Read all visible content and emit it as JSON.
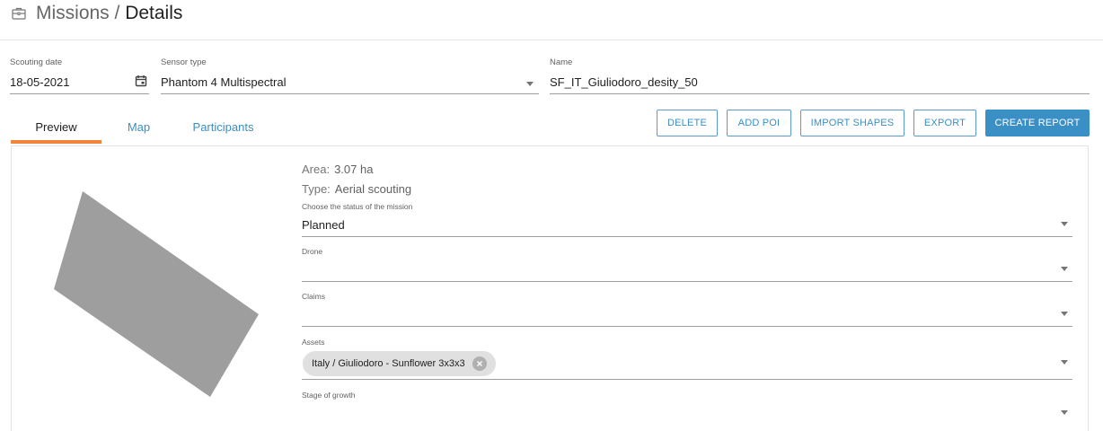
{
  "header": {
    "icon": "briefcase-icon",
    "section": "Missions",
    "separator": " / ",
    "current": "Details"
  },
  "form": {
    "scouting_date": {
      "label": "Scouting date",
      "value": "18-05-2021",
      "icon": "calendar-icon"
    },
    "sensor_type": {
      "label": "Sensor type",
      "value": "Phantom 4 Multispectral"
    },
    "name": {
      "label": "Name",
      "value": "SF_IT_Giuliodoro_desity_50"
    }
  },
  "tabs": [
    {
      "label": "Preview",
      "active": true
    },
    {
      "label": "Map",
      "active": false
    },
    {
      "label": "Participants",
      "active": false
    }
  ],
  "actions": {
    "delete": "DELETE",
    "add_poi": "ADD POI",
    "import_shapes": "IMPORT SHAPES",
    "export": "EXPORT",
    "create_report": "CREATE REPORT"
  },
  "details": {
    "area": {
      "label": "Area:",
      "value": "3.07 ha"
    },
    "type": {
      "label": "Type:",
      "value": "Aerial scouting"
    },
    "status": {
      "label": "Choose the status of the mission",
      "value": "Planned"
    },
    "drone": {
      "label": "Drone",
      "value": ""
    },
    "claims": {
      "label": "Claims",
      "value": ""
    },
    "assets": {
      "label": "Assets",
      "chip": "Italy / Giuliodoro - Sunflower 3x3x3"
    },
    "stage": {
      "label": "Stage of growth",
      "value": ""
    }
  },
  "colors": {
    "accent": "#3a8fc5",
    "tab_indicator": "#f0863a",
    "shape_fill": "#9e9e9e"
  }
}
